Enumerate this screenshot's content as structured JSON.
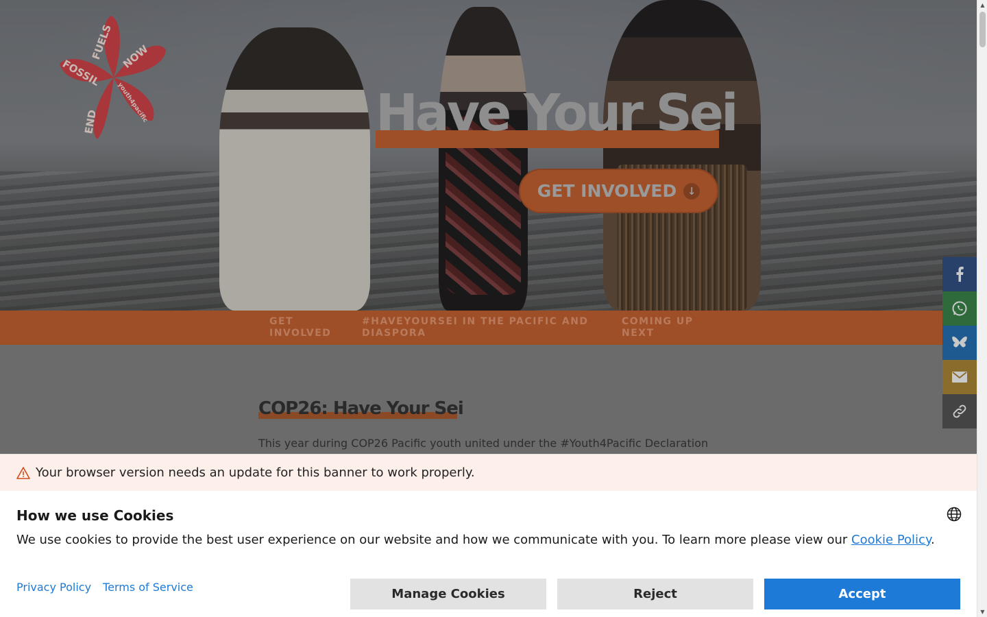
{
  "hero": {
    "title": "Have Your Sei",
    "cta_label": "GET INVOLVED",
    "cta_icon": "arrow-down-icon",
    "logo_words": [
      "FOSSIL",
      "FUELS",
      "NOW",
      "END",
      "youth4pacific"
    ]
  },
  "subnav": {
    "items": [
      {
        "label": "GET INVOLVED"
      },
      {
        "label": "#HAVEYOURSEI IN THE PACIFIC AND DIASPORA"
      },
      {
        "label": "COMING UP NEXT"
      }
    ]
  },
  "article": {
    "title": "COP26: Have Your Sei",
    "text": "This year during COP26 Pacific youth united under the #Youth4Pacific Declaration"
  },
  "share": {
    "items": [
      {
        "icon": "facebook-icon",
        "color": "#3b5998"
      },
      {
        "icon": "whatsapp-icon",
        "color": "#4a9f5a"
      },
      {
        "icon": "bluesky-icon",
        "color": "#2f88d8"
      },
      {
        "icon": "email-icon",
        "color": "#d4a23a"
      },
      {
        "icon": "link-icon",
        "color": "#555555"
      }
    ]
  },
  "cookie": {
    "warning": "Your browser version needs an update for this banner to work properly.",
    "title": "How we use Cookies",
    "text_before": "We use cookies to provide the best user experience on our website and how we communicate with you. To learn more please view our ",
    "policy_link": "Cookie Policy",
    "text_after": ".",
    "privacy_label": "Privacy Policy",
    "terms_label": "Terms of Service",
    "manage_label": "Manage Cookies",
    "reject_label": "Reject",
    "accept_label": "Accept"
  },
  "colors": {
    "brand_orange": "#e2763a",
    "accept_blue": "#1d7ad6",
    "warning_bg": "#fdf0eb"
  }
}
